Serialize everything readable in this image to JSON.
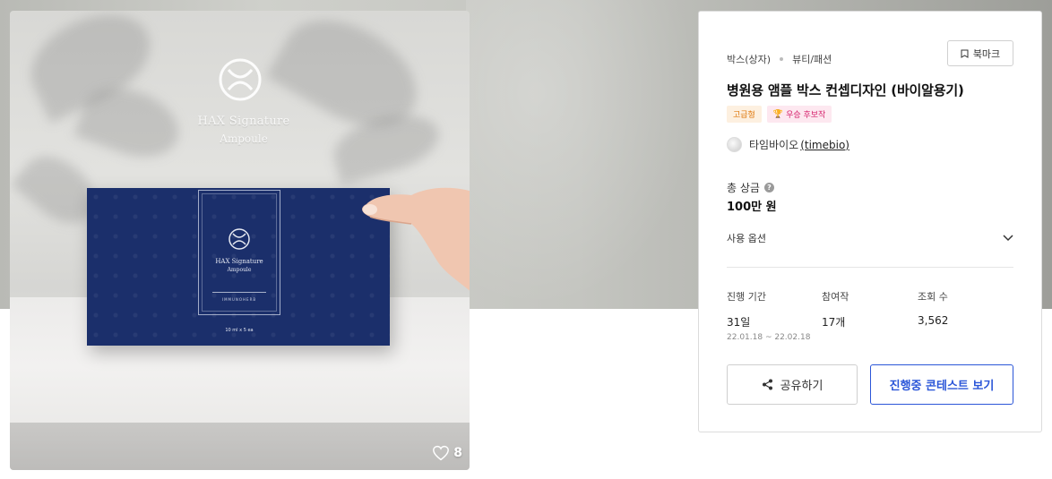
{
  "image": {
    "emboss_line1": "HAX Signature",
    "emboss_line2": "Ampoule",
    "box_name_line1": "HAX Signature",
    "box_name_line2": "Ampoule",
    "box_subtext": "IMMUNOHERB",
    "box_volume": "10 ml x 5 ea",
    "likes": "8",
    "like_icon": "heart-outline-icon"
  },
  "panel": {
    "breadcrumb": [
      "박스(상자)",
      "뷰티/패션"
    ],
    "bookmark_label": "북마크",
    "bookmark_icon": "bookmark-icon",
    "title": "병원용 앰플 박스 컨셉디자인 (바이알용기)",
    "tags": {
      "grade": "고급형",
      "award": "우승 후보작",
      "award_icon": "trophy-icon"
    },
    "owner": {
      "name": "타임바이오",
      "id": "(timebio)"
    },
    "prize": {
      "label": "총 상금",
      "value": "100만 원"
    },
    "usage_label": "사용 옵션",
    "stats": {
      "period_label": "진행 기간",
      "period_value": "31일",
      "period_range": "22.01.18 ~ 22.02.18",
      "entries_label": "참여작",
      "entries_value": "17개",
      "views_label": "조회 수",
      "views_value": "3,562"
    },
    "share_label": "공유하기",
    "contest_label": "진행중 콘테스트 보기"
  },
  "colors": {
    "accent_blue": "#2b56d8",
    "grade_tag": "#e07a10",
    "award_tag": "#d6246e",
    "box_navy": "#1b2f6b"
  }
}
